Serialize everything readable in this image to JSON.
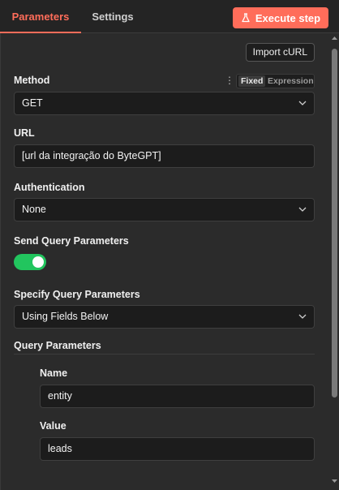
{
  "tabs": {
    "parameters": "Parameters",
    "settings": "Settings"
  },
  "execute_button": "Execute step",
  "import_curl": "Import cURL",
  "method": {
    "label": "Method",
    "mode_fixed": "Fixed",
    "mode_expression": "Expression",
    "value": "GET"
  },
  "url": {
    "label": "URL",
    "value": "[url da integração do ByteGPT]"
  },
  "authentication": {
    "label": "Authentication",
    "value": "None"
  },
  "send_query": {
    "label": "Send Query Parameters",
    "enabled": true
  },
  "specify_query": {
    "label": "Specify Query Parameters",
    "value": "Using Fields Below"
  },
  "query_parameters": {
    "label": "Query Parameters",
    "name_label": "Name",
    "name_value": "entity",
    "value_label": "Value",
    "value_value": "leads"
  },
  "colors": {
    "accent": "#ff6d5a",
    "toggle_on": "#22c55e",
    "background": "#2b2b2b"
  }
}
